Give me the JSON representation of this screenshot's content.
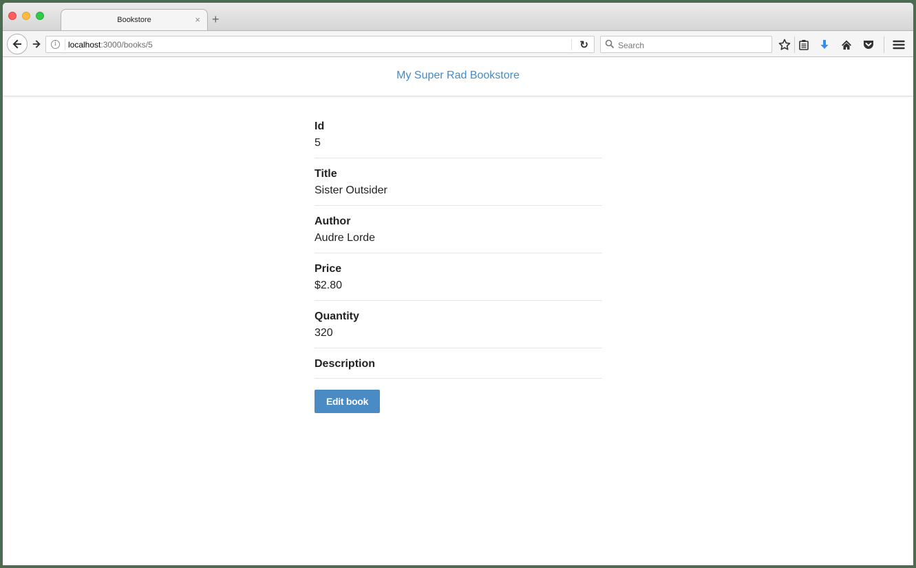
{
  "browser": {
    "tab_title": "Bookstore",
    "tab_close": "×",
    "new_tab": "+",
    "url_host": "localhost",
    "url_rest": ":3000/books/5",
    "search_placeholder": "Search",
    "accent_download": "#2f8ff5"
  },
  "navbar": {
    "brand": "My Super Rad Bookstore",
    "brand_color": "#428bca"
  },
  "book": {
    "fields": [
      {
        "label": "Id",
        "value": "5"
      },
      {
        "label": "Title",
        "value": "Sister Outsider"
      },
      {
        "label": "Author",
        "value": "Audre Lorde"
      },
      {
        "label": "Price",
        "value": "$2.80"
      },
      {
        "label": "Quantity",
        "value": "320"
      },
      {
        "label": "Description",
        "value": ""
      }
    ],
    "edit_label": "Edit book",
    "edit_color": "#4a8bc4"
  }
}
